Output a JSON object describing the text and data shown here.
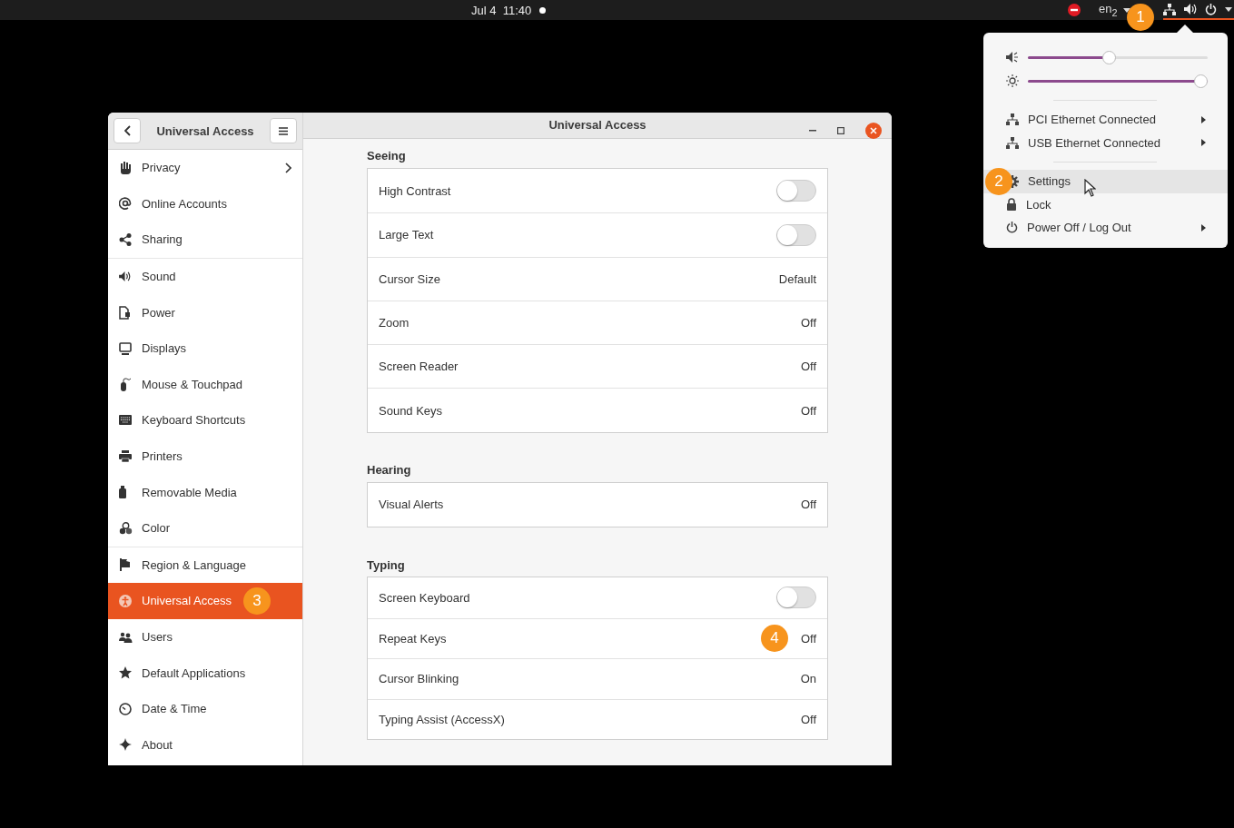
{
  "top_bar": {
    "date_time": "Jul 4  11:40",
    "keyboard_layout": "en$_{2}$",
    "badge": "1"
  },
  "popup": {
    "sliders": [
      {
        "kind": "volume",
        "level": 0.45
      },
      {
        "kind": "brightness",
        "level": 1.0
      }
    ],
    "groups": [
      [
        {
          "label": "PCI Ethernet Connected",
          "submenu": true,
          "highlighted": false
        },
        {
          "label": "USB Ethernet Connected",
          "submenu": true,
          "highlighted": false
        }
      ],
      [
        {
          "label": "Settings",
          "submenu": false,
          "highlighted": true,
          "badge": "2"
        },
        {
          "label": "Lock",
          "submenu": false,
          "highlighted": false
        },
        {
          "label": "Power Off / Log Out",
          "submenu": true,
          "highlighted": false
        }
      ]
    ]
  },
  "window": {
    "sidebar_title": "Universal Access",
    "title": "Universal Access",
    "sidebar": [
      [
        {
          "label": "Privacy",
          "submenu": true,
          "selected": false
        },
        {
          "label": "Online Accounts",
          "submenu": false,
          "selected": false
        },
        {
          "label": "Sharing",
          "submenu": false,
          "selected": false
        }
      ],
      [
        {
          "label": "Sound",
          "submenu": false,
          "selected": false
        },
        {
          "label": "Power",
          "submenu": false,
          "selected": false
        },
        {
          "label": "Displays",
          "submenu": false,
          "selected": false
        },
        {
          "label": "Mouse & Touchpad",
          "submenu": false,
          "selected": false
        },
        {
          "label": "Keyboard Shortcuts",
          "submenu": false,
          "selected": false
        },
        {
          "label": "Printers",
          "submenu": false,
          "selected": false
        },
        {
          "label": "Removable Media",
          "submenu": false,
          "selected": false
        },
        {
          "label": "Color",
          "submenu": false,
          "selected": false
        }
      ],
      [
        {
          "label": "Region & Language",
          "submenu": false,
          "selected": false
        },
        {
          "label": "Universal Access",
          "submenu": false,
          "selected": true,
          "badge": "3"
        },
        {
          "label": "Users",
          "submenu": false,
          "selected": false
        },
        {
          "label": "Default Applications",
          "submenu": false,
          "selected": false
        },
        {
          "label": "Date & Time",
          "submenu": false,
          "selected": false
        },
        {
          "label": "About",
          "submenu": false,
          "selected": false
        }
      ]
    ],
    "sections": [
      {
        "title": "Seeing",
        "rows": [
          {
            "label": "High Contrast",
            "kind": "switch",
            "on": false
          },
          {
            "label": "Large Text",
            "kind": "switch",
            "on": false
          },
          {
            "label": "Cursor Size",
            "kind": "value",
            "value": "Default"
          },
          {
            "label": "Zoom",
            "kind": "value",
            "value": "Off"
          },
          {
            "label": "Screen Reader",
            "kind": "value",
            "value": "Off"
          },
          {
            "label": "Sound Keys",
            "kind": "value",
            "value": "Off"
          }
        ]
      },
      {
        "title": "Hearing",
        "rows": [
          {
            "label": "Visual Alerts",
            "kind": "value",
            "value": "Off"
          }
        ]
      },
      {
        "title": "Typing",
        "rows": [
          {
            "label": "Screen Keyboard",
            "kind": "switch",
            "on": false
          },
          {
            "label": "Repeat Keys",
            "kind": "value",
            "value": "Off",
            "badge": "4"
          },
          {
            "label": "Cursor Blinking",
            "kind": "value",
            "value": "On"
          },
          {
            "label": "Typing Assist (AccessX)",
            "kind": "value",
            "value": "Off"
          }
        ]
      }
    ]
  }
}
